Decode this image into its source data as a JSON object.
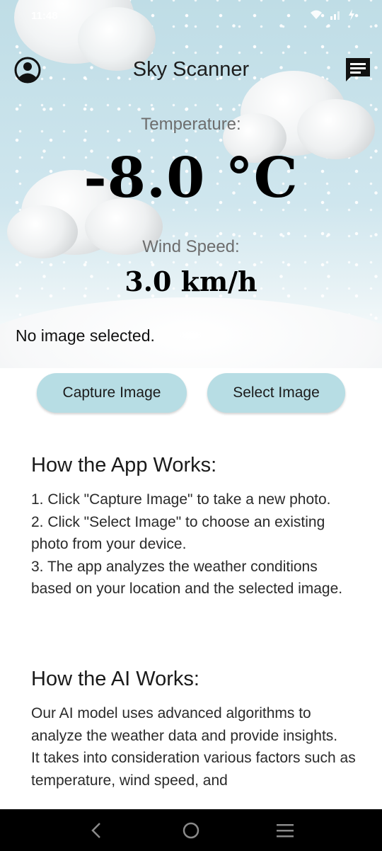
{
  "status_bar": {
    "time": "11:48"
  },
  "app_bar": {
    "title": "Sky Scanner"
  },
  "weather": {
    "temperature_label": "Temperature:",
    "temperature_value": "-8.0 °C",
    "wind_label": "Wind Speed:",
    "wind_value": "3.0 km/h"
  },
  "image_status": "No image selected.",
  "buttons": {
    "capture_label": "Capture Image",
    "select_label": "Select Image"
  },
  "how_app_works": {
    "title": "How the App Works:",
    "body": "1. Click \"Capture Image\" to take a new photo.\n2. Click \"Select Image\" to choose an existing photo from your device.\n3. The app analyzes the weather conditions based on your location and the selected image."
  },
  "how_ai_works": {
    "title": "How the AI Works:",
    "body": "Our AI model uses advanced algorithms to analyze the weather data and provide insights.\nIt takes into consideration various factors such as temperature, wind speed, and"
  },
  "colors": {
    "button_bg": "#b7dde4",
    "sky": "#bfdde6",
    "nav_bar": "#000000"
  },
  "icons": {
    "profile": "account-circle-icon",
    "chat": "chat-icon",
    "back": "back-icon",
    "home": "home-icon",
    "recents": "recents-icon"
  }
}
